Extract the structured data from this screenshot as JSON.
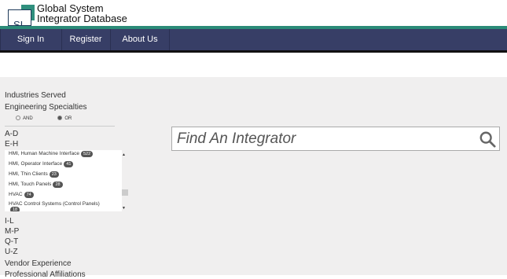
{
  "header": {
    "logo_text": "SI",
    "title_line1": "Global System",
    "title_line2": "Integrator Database"
  },
  "nav": {
    "items": [
      {
        "label": "Sign In"
      },
      {
        "label": "Register"
      },
      {
        "label": "About Us"
      }
    ]
  },
  "sidebar": {
    "industries": "Industries Served",
    "engineering": "Engineering Specialties",
    "radio_and": "AND",
    "radio_or": "OR",
    "ranges": [
      "A-D",
      "E-H",
      "I-L",
      "M-P",
      "Q-T",
      "U-Z"
    ],
    "vendor": "Vendor Experience",
    "professional": "Professional Affiliations",
    "list": [
      {
        "label": "HMI, Human Machine Interface",
        "count": "522"
      },
      {
        "label": "HMI, Operator Interface",
        "count": "41"
      },
      {
        "label": "HMI, Thin Clients",
        "count": "23"
      },
      {
        "label": "HMI, Touch Panels",
        "count": "28"
      },
      {
        "label": "HVAC",
        "count": "74"
      },
      {
        "label": "HVAC Control Systems (Control Panels)",
        "count": "18"
      }
    ]
  },
  "search": {
    "placeholder": "Find An Integrator"
  },
  "colors": {
    "nav_bg": "#373e66",
    "teal": "#2b8b78",
    "content_bg": "#f0efef"
  }
}
